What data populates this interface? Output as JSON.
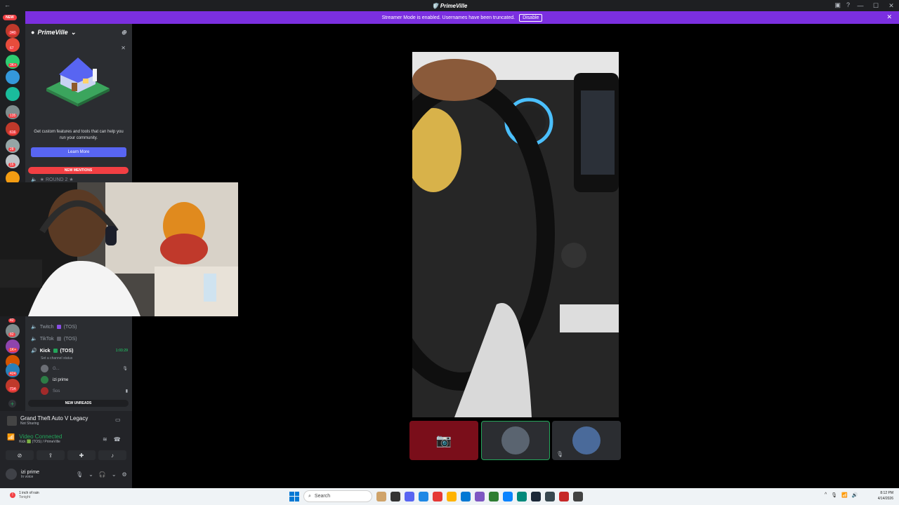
{
  "window": {
    "title": "🛡️ PrimeVille",
    "controls": [
      "—",
      "☐",
      "✕"
    ]
  },
  "banner": {
    "message": "Streamer Mode is enabled. Usernames have been truncated.",
    "disable_label": "Disable"
  },
  "servers": {
    "new_label": "NEW",
    "badges": [
      "340",
      "67",
      "3K+",
      "135",
      "616",
      "28",
      "16",
      "42",
      "82",
      "1K+",
      "9",
      "424",
      "714"
    ]
  },
  "sidebar": {
    "server_name": "PrimeVille",
    "promo": {
      "text": "Get custom features and tools that can help you run your community.",
      "button": "Learn More"
    },
    "new_mentions": "NEW MENTIONS",
    "round_label": "★ ROUND 2 ★",
    "channels": [
      {
        "name": "Twitch",
        "tag": "(TOS)",
        "color": "#8a4fe5"
      },
      {
        "name": "TikTok",
        "tag": "(TOS)",
        "color": "#5e6068"
      },
      {
        "name": "Kick",
        "tag": "(TOS)",
        "color": "#23a55a",
        "timer": "1:03:29",
        "status": "Set a channel status"
      }
    ],
    "members": [
      {
        "name": "G..."
      },
      {
        "name": "izi prime"
      },
      {
        "name": "Sos"
      }
    ],
    "new_unreads": "NEW UNREADS"
  },
  "panel": {
    "game_title": "Grand Theft Auto V Legacy",
    "game_status": "Not Sharing",
    "voice_title": "Video Connected",
    "voice_channel": "Kick 🟩 (TOS) / PrimeVille",
    "user_name": "izi prime",
    "user_status": "In voice"
  },
  "taskbar": {
    "weather_title": "1 inch of rain",
    "weather_sub": "Tonight",
    "search_placeholder": "Search",
    "time": "8:12 PM",
    "date": "4/14/2026"
  },
  "colors": {
    "accent": "#5865f2",
    "banner": "#7b2fe0",
    "danger": "#f23f43",
    "online": "#23a55a"
  }
}
